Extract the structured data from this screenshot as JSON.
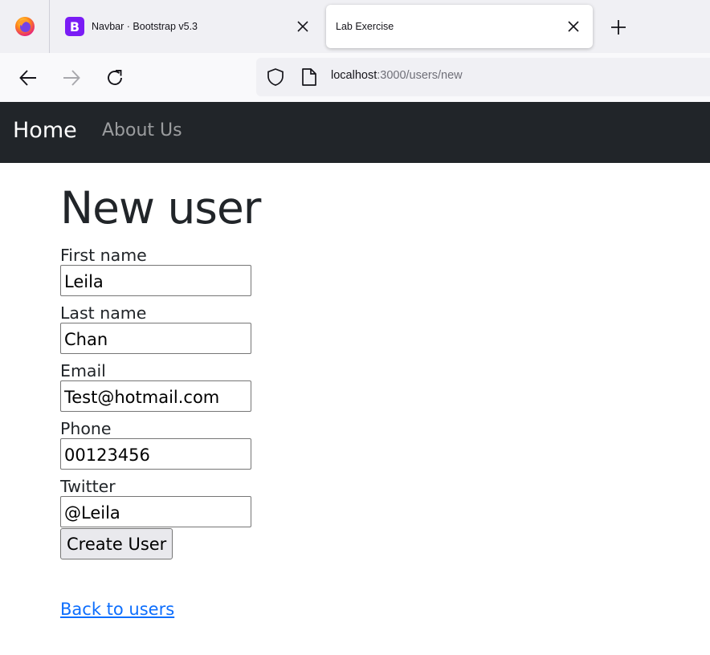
{
  "browser": {
    "tabs": [
      {
        "title": "Navbar · Bootstrap v5.3",
        "favicon_letter": "B",
        "active": false
      },
      {
        "title": "Lab Exercise",
        "active": true
      }
    ],
    "url": {
      "host": "localhost",
      "rest": ":3000/users/new"
    }
  },
  "navbar": {
    "brand": "Home",
    "links": [
      "About Us"
    ]
  },
  "page": {
    "title": "New user",
    "fields": [
      {
        "label": "First name",
        "value": "Leila"
      },
      {
        "label": "Last name",
        "value": "Chan"
      },
      {
        "label": "Email",
        "value": "Test@hotmail.com"
      },
      {
        "label": "Phone",
        "value": "00123456"
      },
      {
        "label": "Twitter",
        "value": "@Leila"
      }
    ],
    "submit_label": "Create User",
    "back_link": "Back to users"
  },
  "colors": {
    "navbar_bg": "#212529",
    "link": "#0d6efd",
    "bootstrap_purple": "#7a1cf5"
  },
  "icons": [
    "firefox-logo-icon",
    "close-icon",
    "plus-icon",
    "back-arrow-icon",
    "forward-arrow-icon",
    "reload-icon",
    "shield-icon",
    "page-icon"
  ]
}
